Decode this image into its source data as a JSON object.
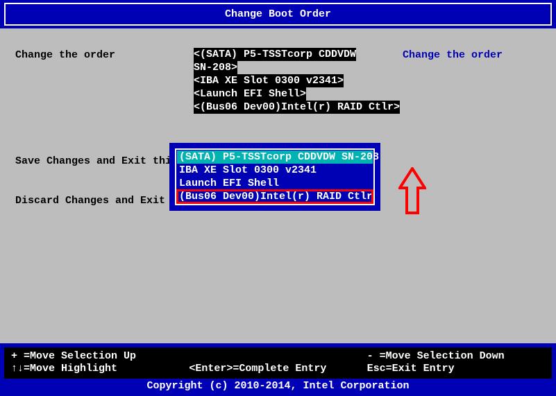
{
  "title": "Change Boot Order",
  "label_change_order": "Change the order",
  "help_text": "Change the order",
  "boot_items_bg_line1a": "<(SATA) P5-TSSTcorp CDDVDW",
  "boot_items_bg_line1b": "SN-208>",
  "boot_items_bg_line2": "<IBA XE Slot 0300 v2341>",
  "boot_items_bg_line3": "<Launch EFI Shell>",
  "boot_items_bg_line4": "<(Bus06 Dev00)Intel(r) RAID Ctlr>",
  "sub_line1": "Save Changes and Exit this sub-menu",
  "sub_line2": "Discard Changes and Exit th",
  "popup": {
    "item1": "(SATA) P5-TSSTcorp CDDVDW SN-208",
    "item2": "IBA XE Slot 0300 v2341",
    "item3": "Launch EFI Shell",
    "item4": "(Bus06 Dev00)Intel(r) RAID Ctlr"
  },
  "footer": {
    "r1c1": "+ =Move Selection Up",
    "r1c2": "",
    "r1c3": "- =Move Selection Down",
    "r2c1": "↑↓=Move Highlight",
    "r2c2": "<Enter>=Complete Entry",
    "r2c3": "Esc=Exit Entry",
    "copyright": "Copyright (c) 2010-2014, Intel Corporation"
  }
}
